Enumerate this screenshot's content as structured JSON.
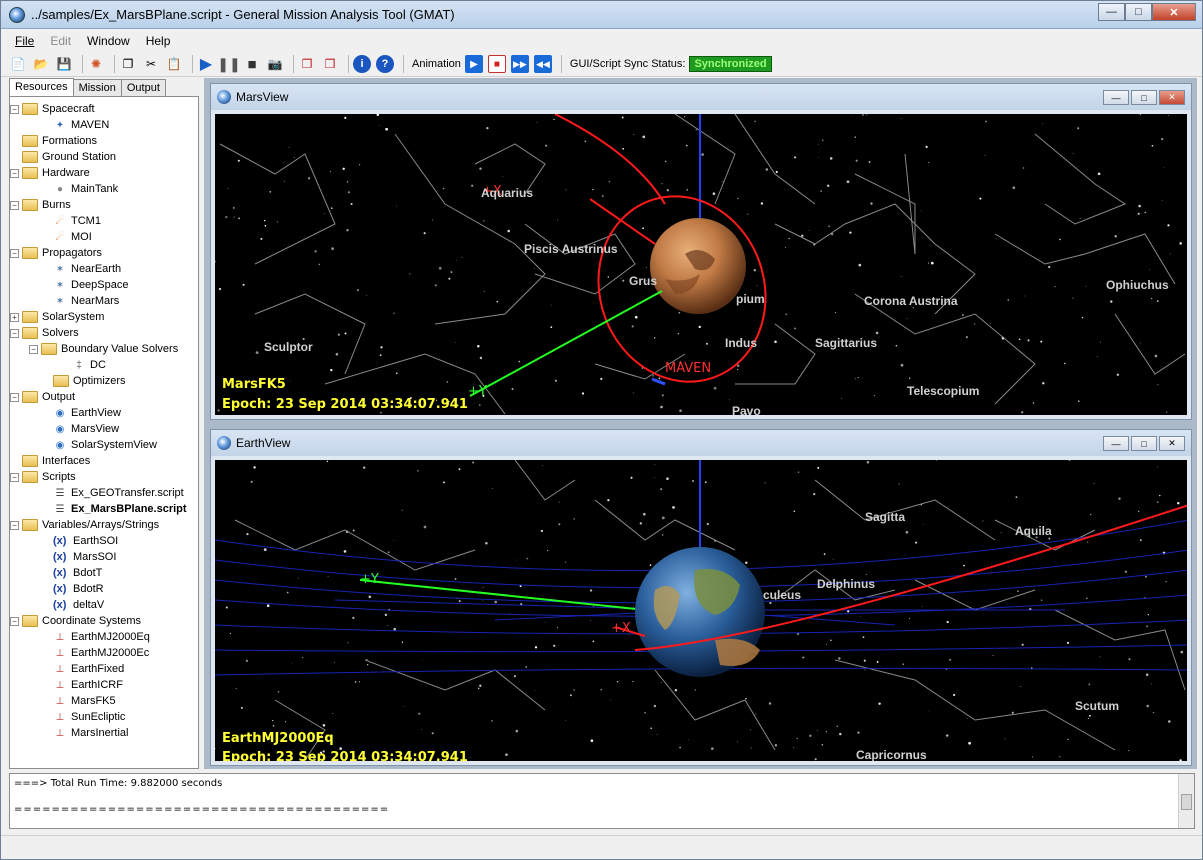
{
  "window": {
    "title": "../samples/Ex_MarsBPlane.script - General Mission Analysis Tool (GMAT)"
  },
  "menu": [
    "File",
    "Edit",
    "Window",
    "Help"
  ],
  "toolbar": {
    "animation_label": "Animation",
    "sync_label": "GUI/Script Sync Status:",
    "sync_status": "Synchronized"
  },
  "panel_tabs": [
    "Resources",
    "Mission",
    "Output"
  ],
  "tree": [
    {
      "label": "Spacecraft",
      "level": 0,
      "icon": "folder",
      "expand": "-"
    },
    {
      "label": "MAVEN",
      "level": 1,
      "icon": "spacecraft-icon"
    },
    {
      "label": "Formations",
      "level": 0,
      "icon": "folder"
    },
    {
      "label": "Ground Station",
      "level": 0,
      "icon": "folder"
    },
    {
      "label": "Hardware",
      "level": 0,
      "icon": "folder",
      "expand": "-"
    },
    {
      "label": "MainTank",
      "level": 1,
      "icon": "tank-icon"
    },
    {
      "label": "Burns",
      "level": 0,
      "icon": "folder",
      "expand": "-"
    },
    {
      "label": "TCM1",
      "level": 1,
      "icon": "burn-icon"
    },
    {
      "label": "MOI",
      "level": 1,
      "icon": "burn-icon"
    },
    {
      "label": "Propagators",
      "level": 0,
      "icon": "folder",
      "expand": "-"
    },
    {
      "label": "NearEarth",
      "level": 1,
      "icon": "propagator-icon"
    },
    {
      "label": "DeepSpace",
      "level": 1,
      "icon": "propagator-icon"
    },
    {
      "label": "NearMars",
      "level": 1,
      "icon": "propagator-icon"
    },
    {
      "label": "SolarSystem",
      "level": 0,
      "icon": "folder",
      "expand": "+"
    },
    {
      "label": "Solvers",
      "level": 0,
      "icon": "folder",
      "expand": "-"
    },
    {
      "label": "Boundary Value Solvers",
      "level": 1,
      "icon": "folder",
      "expand": "-"
    },
    {
      "label": "DC",
      "level": 2,
      "icon": "solver-icon"
    },
    {
      "label": "Optimizers",
      "level": 1,
      "icon": "folder"
    },
    {
      "label": "Output",
      "level": 0,
      "icon": "folder",
      "expand": "-"
    },
    {
      "label": "EarthView",
      "level": 1,
      "icon": "globe-icon"
    },
    {
      "label": "MarsView",
      "level": 1,
      "icon": "globe-icon"
    },
    {
      "label": "SolarSystemView",
      "level": 1,
      "icon": "globe-icon"
    },
    {
      "label": "Interfaces",
      "level": 0,
      "icon": "folder"
    },
    {
      "label": "Scripts",
      "level": 0,
      "icon": "folder",
      "expand": "-"
    },
    {
      "label": "Ex_GEOTransfer.script",
      "level": 1,
      "icon": "script-icon"
    },
    {
      "label": "Ex_MarsBPlane.script",
      "level": 1,
      "icon": "script-icon",
      "bold": true
    },
    {
      "label": "Variables/Arrays/Strings",
      "level": 0,
      "icon": "folder",
      "expand": "-"
    },
    {
      "label": "EarthSOI",
      "level": 1,
      "icon": "variable-icon"
    },
    {
      "label": "MarsSOI",
      "level": 1,
      "icon": "variable-icon"
    },
    {
      "label": "BdotT",
      "level": 1,
      "icon": "variable-icon"
    },
    {
      "label": "BdotR",
      "level": 1,
      "icon": "variable-icon"
    },
    {
      "label": "deltaV",
      "level": 1,
      "icon": "variable-icon"
    },
    {
      "label": "Coordinate Systems",
      "level": 0,
      "icon": "folder",
      "expand": "-"
    },
    {
      "label": "EarthMJ2000Eq",
      "level": 1,
      "icon": "axes-icon"
    },
    {
      "label": "EarthMJ2000Ec",
      "level": 1,
      "icon": "axes-icon"
    },
    {
      "label": "EarthFixed",
      "level": 1,
      "icon": "axes-icon"
    },
    {
      "label": "EarthICRF",
      "level": 1,
      "icon": "axes-icon"
    },
    {
      "label": "MarsFK5",
      "level": 1,
      "icon": "axes-icon"
    },
    {
      "label": "SunEcliptic",
      "level": 1,
      "icon": "axes-icon"
    },
    {
      "label": "MarsInertial",
      "level": 1,
      "icon": "axes-icon"
    }
  ],
  "marsview": {
    "title": "MarsView",
    "coord_system": "MarsFK5",
    "epoch": "Epoch: 23 Sep 2014 03:34:07.941",
    "spacecraft_label": "MAVEN",
    "axis_x": "+X",
    "axis_y": "+Y",
    "constellations": [
      "Aquarius",
      "Piscis Austrinus",
      "Grus",
      "Ophiuchus",
      "Corona Austrina",
      "pium",
      "Sculptor",
      "Indus",
      "Sagittarius",
      "Telescopium",
      "Pavo"
    ]
  },
  "earthview": {
    "title": "EarthView",
    "coord_system": "EarthMJ2000Eq",
    "epoch": "Epoch: 23 Sep 2014 03:34:07.941",
    "axis_x": "+X",
    "axis_y": "+Y",
    "constellations": [
      "Sagitta",
      "Aquila",
      "Delphinus",
      "culeus",
      "Scutum",
      "Capricornus"
    ]
  },
  "output": {
    "line1": "===> Total Run Time: 9.882000 seconds",
    "line2": "========================================"
  }
}
